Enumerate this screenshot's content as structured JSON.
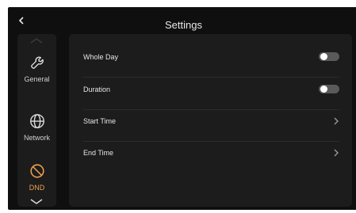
{
  "header": {
    "title": "Settings",
    "back_icon": "chevron-left-icon"
  },
  "sidebar": {
    "items": [
      {
        "label": "General",
        "icon": "wrench-icon",
        "active": false
      },
      {
        "label": "Network",
        "icon": "globe-icon",
        "active": false
      },
      {
        "label": "DND",
        "icon": "do-not-disturb-icon",
        "active": true
      }
    ],
    "scroll_up_icon": "chevron-up-icon",
    "scroll_down_icon": "chevron-down-icon"
  },
  "settings": {
    "rows": [
      {
        "label": "Whole Day",
        "control": "toggle",
        "on": false
      },
      {
        "label": "Duration",
        "control": "toggle",
        "on": false
      },
      {
        "label": "Start Time",
        "control": "chevron-right-icon"
      },
      {
        "label": "End Time",
        "control": "chevron-right-icon"
      }
    ]
  },
  "colors": {
    "background": "#0f0f0f",
    "panel": "#1c1c1c",
    "accent": "#f0a04b",
    "toggle_off_track": "#5a5a5a"
  }
}
